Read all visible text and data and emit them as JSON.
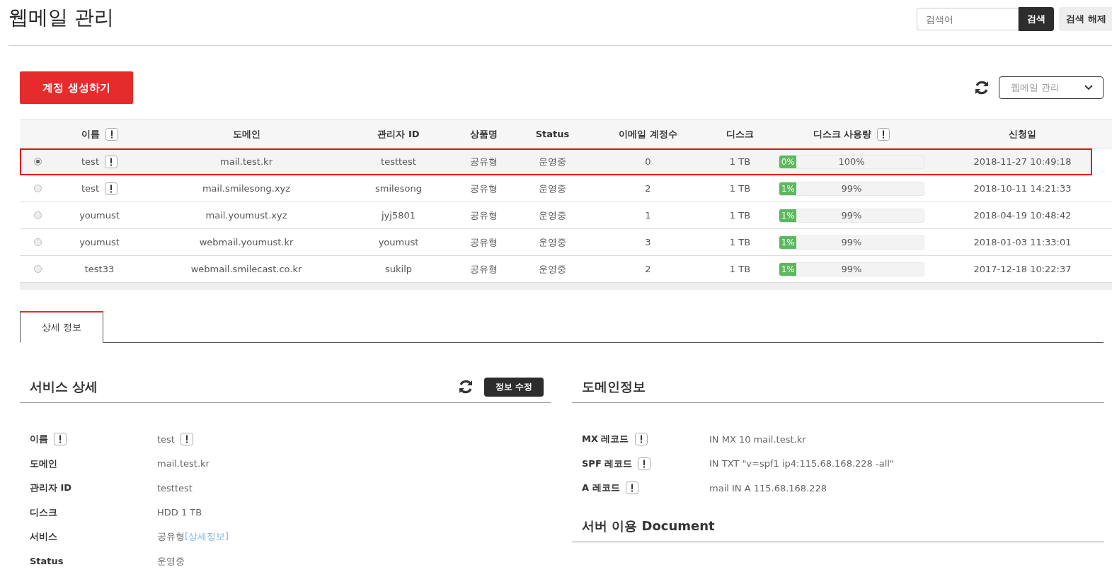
{
  "page": {
    "title": "웹메일 관리"
  },
  "search": {
    "placeholder": "검색어",
    "button": "검색",
    "clear_button": "검색 해제"
  },
  "create_button": "계정 생성하기",
  "view_select": {
    "placeholder": "웹메일 관리"
  },
  "table": {
    "columns": [
      {
        "label": "이름",
        "info": true
      },
      {
        "label": "도메인",
        "info": false
      },
      {
        "label": "관리자 ID",
        "info": false
      },
      {
        "label": "상품명",
        "info": false
      },
      {
        "label": "Status",
        "info": false
      },
      {
        "label": "이메일 계정수",
        "info": false
      },
      {
        "label": "디스크",
        "info": false
      },
      {
        "label": "디스크 사용량",
        "info": true
      },
      {
        "label": "신청일",
        "info": false
      }
    ],
    "rows": [
      {
        "selected": true,
        "name": "test",
        "name_info": true,
        "domain": "mail.test.kr",
        "admin_id": "testtest",
        "product": "공유형",
        "status": "운영중",
        "email_count": "0",
        "disk": "1 TB",
        "usage": {
          "used": "0%",
          "free": "100%",
          "level": 0.12
        },
        "date": "2018-11-27 10:49:18"
      },
      {
        "selected": false,
        "name": "test",
        "name_info": true,
        "domain": "mail.smilesong.xyz",
        "admin_id": "smilesong",
        "product": "공유형",
        "status": "운영중",
        "email_count": "2",
        "disk": "1 TB",
        "usage": {
          "used": "1%",
          "free": "99%",
          "level": 0.12
        },
        "date": "2018-10-11 14:21:33"
      },
      {
        "selected": false,
        "name": "youmust",
        "name_info": false,
        "domain": "mail.youmust.xyz",
        "admin_id": "jyj5801",
        "product": "공유형",
        "status": "운영중",
        "email_count": "1",
        "disk": "1 TB",
        "usage": {
          "used": "1%",
          "free": "99%",
          "level": 0.12
        },
        "date": "2018-04-19 10:48:42"
      },
      {
        "selected": false,
        "name": "youmust",
        "name_info": false,
        "domain": "webmail.youmust.kr",
        "admin_id": "youmust",
        "product": "공유형",
        "status": "운영중",
        "email_count": "3",
        "disk": "1 TB",
        "usage": {
          "used": "1%",
          "free": "99%",
          "level": 0.12
        },
        "date": "2018-01-03 11:33:01"
      },
      {
        "selected": false,
        "name": "test33",
        "name_info": false,
        "domain": "webmail.smilecast.co.kr",
        "admin_id": "sukilp",
        "product": "공유형",
        "status": "운영중",
        "email_count": "2",
        "disk": "1 TB",
        "usage": {
          "used": "1%",
          "free": "99%",
          "level": 0.12
        },
        "date": "2017-12-18 10:22:37"
      }
    ]
  },
  "tabs": [
    {
      "label": "상세 정보",
      "selected": true
    }
  ],
  "service_detail": {
    "title": "서비스 상세",
    "edit_button": "정보 수정",
    "fields": [
      {
        "label": "이름",
        "label_info": true,
        "value": "test",
        "value_info": true
      },
      {
        "label": "도메인",
        "label_info": false,
        "value": "mail.test.kr",
        "value_info": false
      },
      {
        "label": "관리자 ID",
        "label_info": false,
        "value": "testtest",
        "value_info": false
      },
      {
        "label": "디스크",
        "label_info": false,
        "value": "HDD 1 TB",
        "value_info": false
      },
      {
        "label": "서비스",
        "label_info": false,
        "value": "공유형",
        "value_info": false,
        "link": "[상세정보]"
      },
      {
        "label": "Status",
        "label_info": false,
        "value": "운영중",
        "value_info": false
      }
    ]
  },
  "domain_info": {
    "title": "도메인정보",
    "fields": [
      {
        "label": "MX 레코드",
        "label_info": true,
        "value": "IN MX 10 mail.test.kr"
      },
      {
        "label": "SPF 레코드",
        "label_info": true,
        "value": "IN TXT \"v=spf1 ip4:115.68.168.228 -all\""
      },
      {
        "label": "A 레코드",
        "label_info": true,
        "value": "mail IN A 115.68.168.228"
      }
    ]
  },
  "document": {
    "title": "서버 이용 Document"
  }
}
